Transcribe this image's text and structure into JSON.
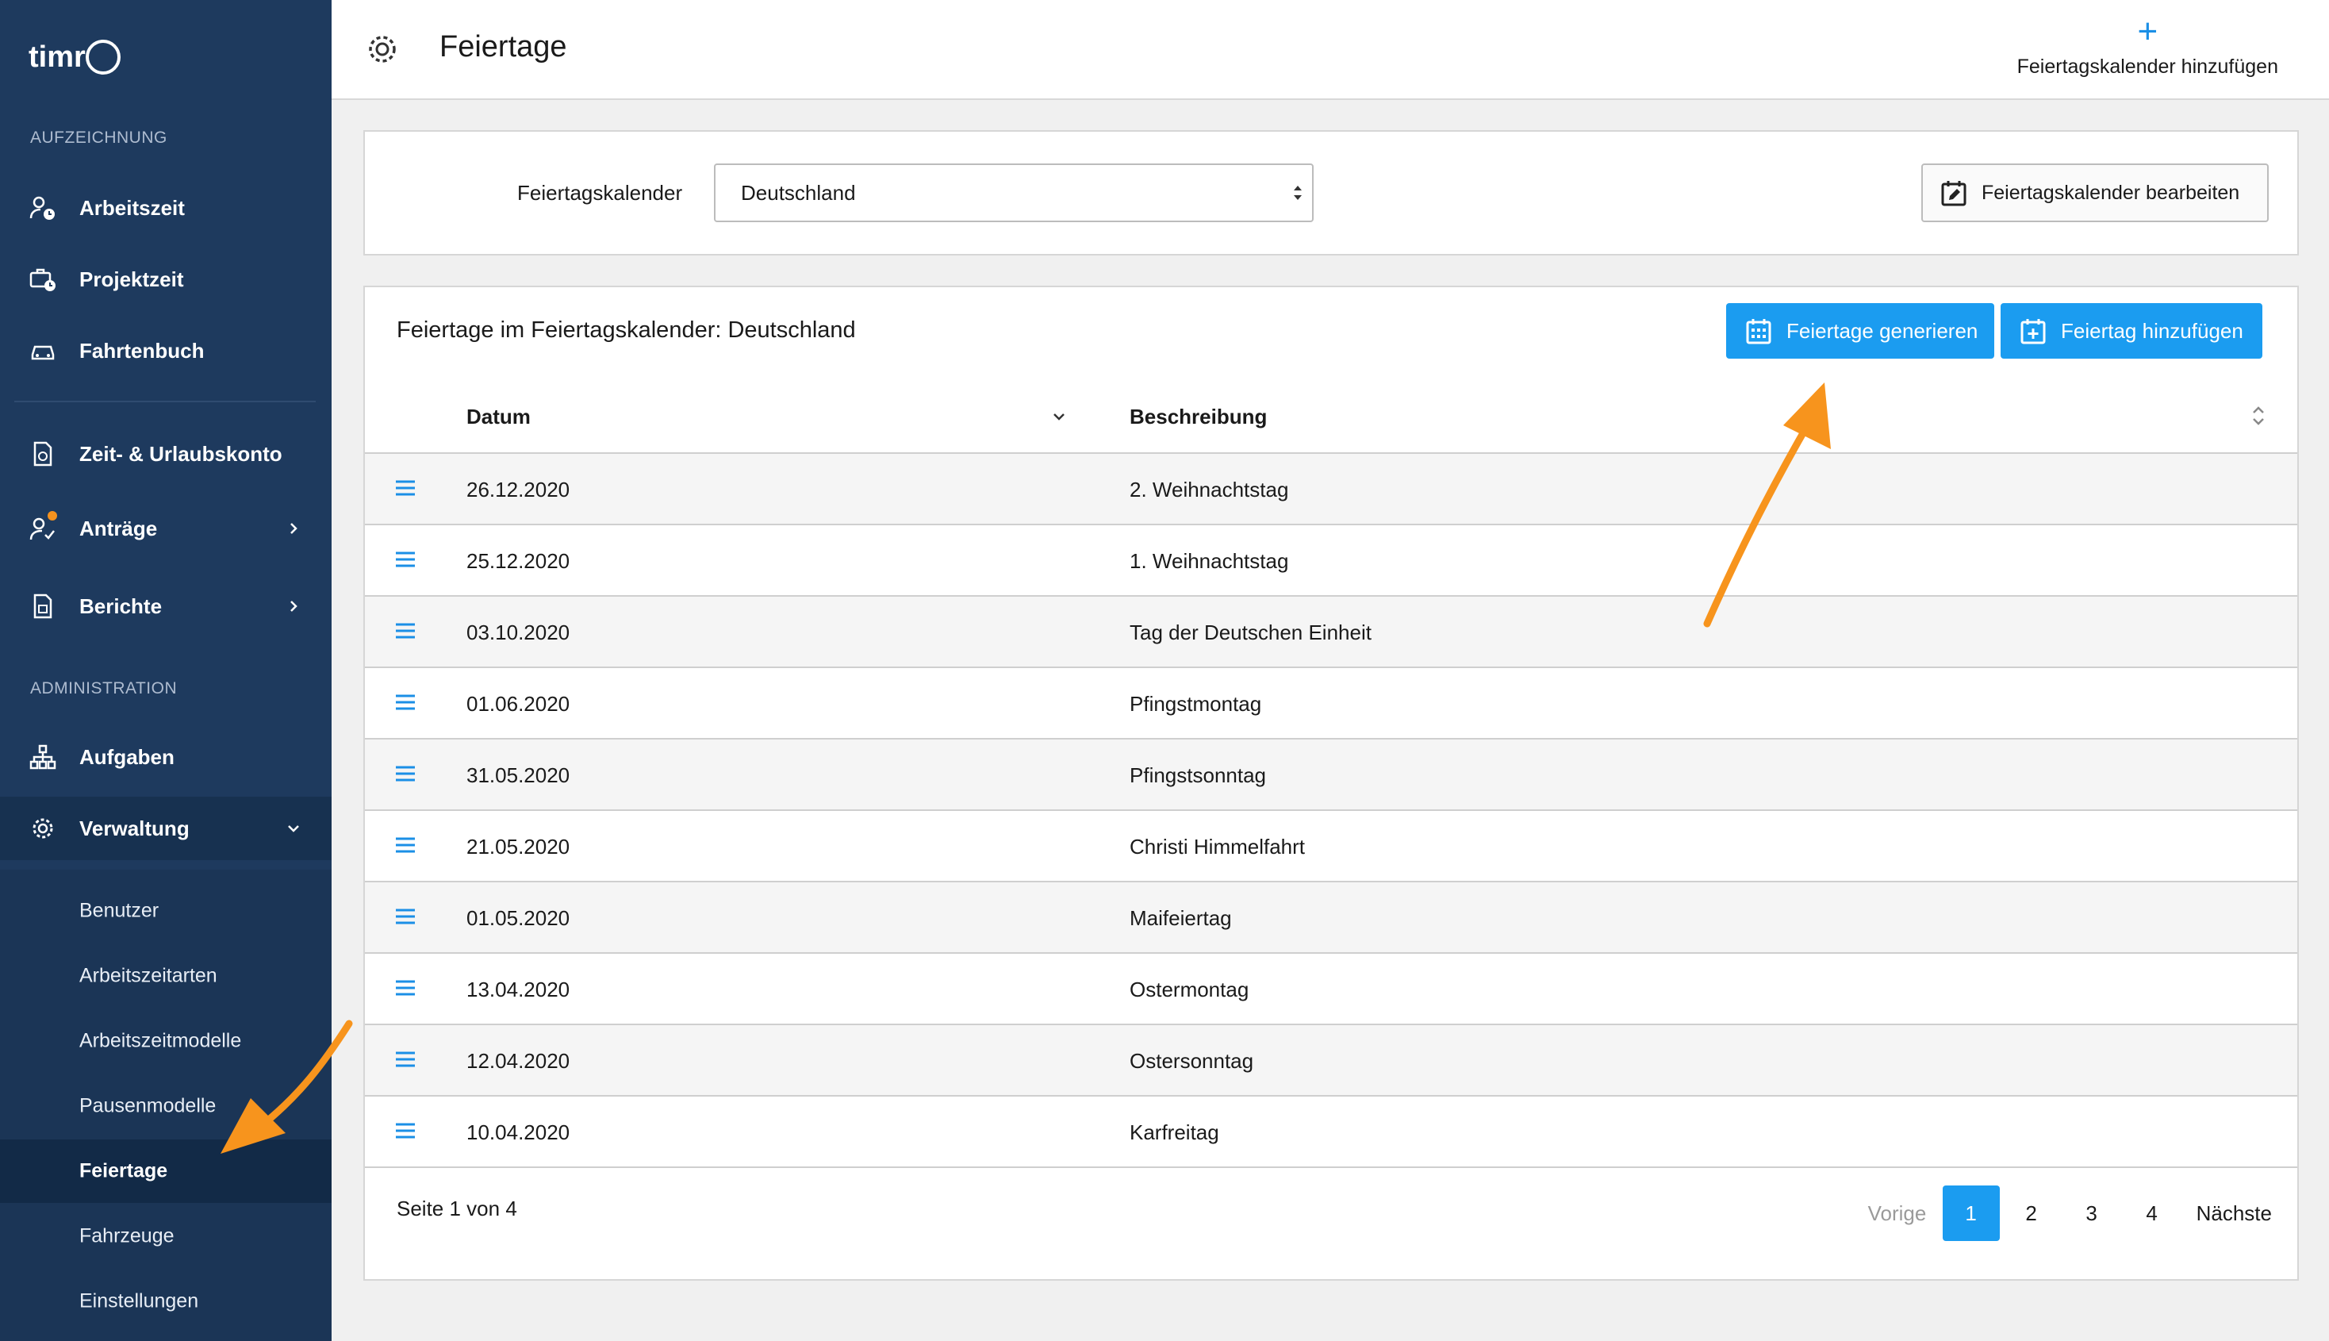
{
  "app": {
    "logo_text": "timr"
  },
  "sidebar": {
    "section_recording": "AUFZEICHNUNG",
    "section_admin": "ADMINISTRATION",
    "items": [
      {
        "label": "Arbeitszeit",
        "icon": "user-clock-icon"
      },
      {
        "label": "Projektzeit",
        "icon": "briefcase-clock-icon"
      },
      {
        "label": "Fahrtenbuch",
        "icon": "car-icon"
      },
      {
        "label": "Zeit- & Urlaubskonto",
        "icon": "document-clock-icon"
      },
      {
        "label": "Anträge",
        "icon": "user-check-icon"
      },
      {
        "label": "Berichte",
        "icon": "report-icon"
      },
      {
        "label": "Aufgaben",
        "icon": "hierarchy-icon"
      },
      {
        "label": "Verwaltung",
        "icon": "gear-icon"
      }
    ],
    "sub_items": [
      {
        "label": "Benutzer"
      },
      {
        "label": "Arbeitszeitarten"
      },
      {
        "label": "Arbeitszeitmodelle"
      },
      {
        "label": "Pausenmodelle"
      },
      {
        "label": "Feiertage"
      },
      {
        "label": "Fahrzeuge"
      },
      {
        "label": "Einstellungen"
      }
    ],
    "notification_color": "#f5921e"
  },
  "header": {
    "title": "Feiertage",
    "add_calendar_label": "Feiertagskalender hinzufügen",
    "add_calendar_icon": "+"
  },
  "calendar_select": {
    "label": "Feiertagskalender",
    "value": "Deutschland",
    "edit_button": "Feiertagskalender bearbeiten"
  },
  "holidays": {
    "title": "Feiertage im Feiertagskalender: Deutschland",
    "generate_button": "Feiertage generieren",
    "add_button": "Feiertag hinzufügen",
    "col_date": "Datum",
    "col_desc": "Beschreibung",
    "rows": [
      {
        "date": "26.12.2020",
        "desc": "2. Weihnachtstag"
      },
      {
        "date": "25.12.2020",
        "desc": "1. Weihnachtstag"
      },
      {
        "date": "03.10.2020",
        "desc": "Tag der Deutschen Einheit"
      },
      {
        "date": "01.06.2020",
        "desc": "Pfingstmontag"
      },
      {
        "date": "31.05.2020",
        "desc": "Pfingstsonntag"
      },
      {
        "date": "21.05.2020",
        "desc": "Christi Himmelfahrt"
      },
      {
        "date": "01.05.2020",
        "desc": "Maifeiertag"
      },
      {
        "date": "13.04.2020",
        "desc": "Ostermontag"
      },
      {
        "date": "12.04.2020",
        "desc": "Ostersonntag"
      },
      {
        "date": "10.04.2020",
        "desc": "Karfreitag"
      }
    ],
    "page_info": "Seite 1 von 4",
    "pager": {
      "prev": "Vorige",
      "pages": [
        "1",
        "2",
        "3",
        "4"
      ],
      "next": "Nächste"
    }
  },
  "colors": {
    "primary": "#1b9cf0",
    "sidebar": "#1e3a5e",
    "annotation_arrow": "#f7941d"
  }
}
